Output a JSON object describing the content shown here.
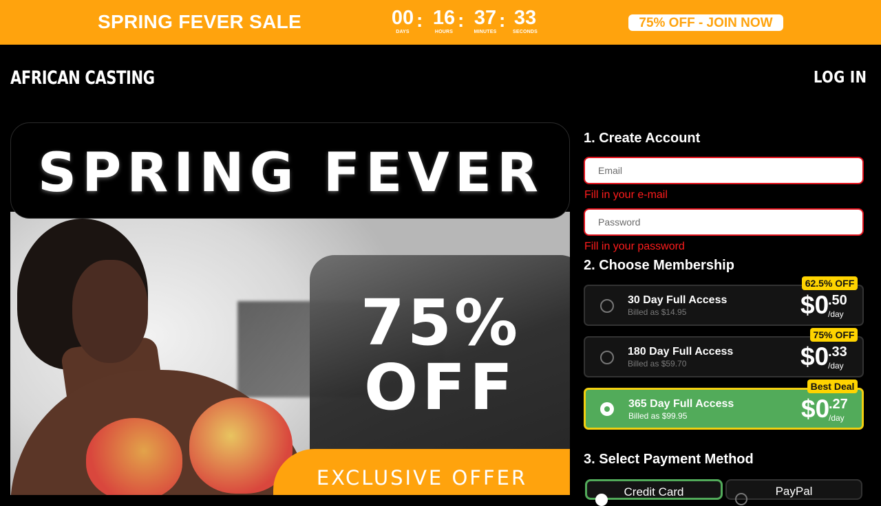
{
  "banner": {
    "title": "SPRING FEVER SALE",
    "countdown": [
      {
        "value": "00",
        "label": "DAYS"
      },
      {
        "value": "16",
        "label": "HOURS"
      },
      {
        "value": "37",
        "label": "MINUTES"
      },
      {
        "value": "33",
        "label": "SECONDS"
      }
    ],
    "separator": ":",
    "cta": "75% OFF - JOIN NOW"
  },
  "header": {
    "logo": "AFRICAN CASTING",
    "login": "LOG IN"
  },
  "hero": {
    "title": "SPRING FEVER",
    "discount": "75%",
    "off": "OFF",
    "exclusive": "EXCLUSIVE OFFER"
  },
  "form": {
    "step1": "1. Create Account",
    "email_placeholder": "Email",
    "email_error": "Fill in your e-mail",
    "password_placeholder": "Password",
    "password_error": "Fill in your password",
    "step2": "2. Choose Membership",
    "plans": [
      {
        "name": "30 Day Full Access",
        "billed": "Billed as $14.95",
        "price_main": "$0",
        "price_cents": ".50",
        "per": "/day",
        "badge": "62.5% OFF",
        "selected": false
      },
      {
        "name": "180 Day Full Access",
        "billed": "Billed as $59.70",
        "price_main": "$0",
        "price_cents": ".33",
        "per": "/day",
        "badge": "75% OFF",
        "selected": false
      },
      {
        "name": "365 Day Full Access",
        "billed": "Billed as $99.95",
        "price_main": "$0",
        "price_cents": ".27",
        "per": "/day",
        "badge": "Best Deal",
        "selected": true
      }
    ],
    "step3": "3. Select Payment Method",
    "payment": [
      {
        "label": "Credit Card",
        "selected": true
      },
      {
        "label": "PayPal",
        "selected": false
      }
    ]
  },
  "colors": {
    "accent_orange": "#ffa30d",
    "selected_green": "#52ab5a",
    "badge_yellow": "#ffd400",
    "error_red": "#e0121c"
  }
}
